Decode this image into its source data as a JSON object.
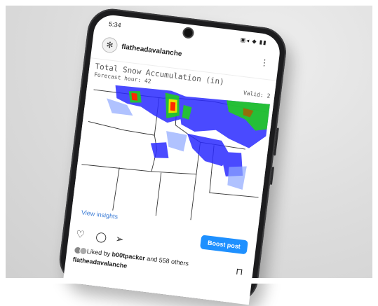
{
  "status_bar": {
    "time": "5:34",
    "icons": "▣◂ ◆ ▮▮"
  },
  "post": {
    "username": "flatheadavalanche",
    "more_label": "⋮",
    "map": {
      "title": "Total Snow Accumulation (in)",
      "forecast_hour": "Forecast hour:  42",
      "valid": "Valid: 2"
    },
    "view_insights": "View insights",
    "boost_label": "Boost post",
    "actions": {
      "like": "♡",
      "comment": "◯",
      "share": "➢"
    },
    "bookmark": "⊓",
    "likes_prefix": "Liked by",
    "liker": "b00tpacker",
    "likes_suffix": "and 558 others",
    "caption": "flatheadavalanche"
  },
  "colors": {
    "accent": "#1e90ff",
    "link": "#3a7bd5",
    "snow_blue": "#2b2bff",
    "snow_green": "#22cc22",
    "snow_red": "#ff2a00"
  }
}
